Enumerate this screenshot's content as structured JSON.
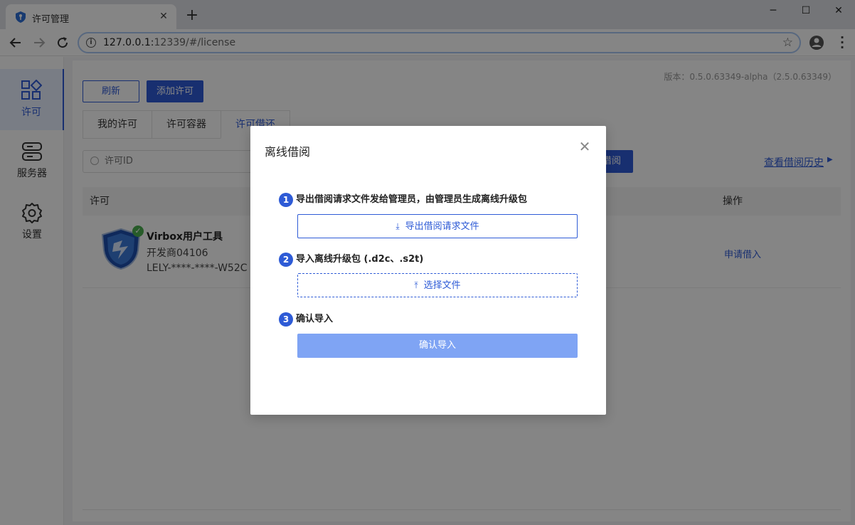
{
  "browser": {
    "tab_title": "许可管理",
    "url_host": "127.0.0.1:",
    "url_rest": "12339/#/license"
  },
  "sidebar": {
    "items": [
      {
        "label": "许可",
        "icon": "apps-grid-icon",
        "active": true
      },
      {
        "label": "服务器",
        "icon": "server-icon",
        "active": false
      },
      {
        "label": "设置",
        "icon": "gear-icon",
        "active": false
      }
    ]
  },
  "main": {
    "version": "版本：0.5.0.63349-alpha（2.5.0.63349）",
    "refresh_label": "刷新",
    "add_label": "添加许可",
    "tabs": [
      {
        "label": "我的许可"
      },
      {
        "label": "许可容器"
      },
      {
        "label": "许可借还",
        "active": true
      }
    ],
    "search_placeholder": "许可ID",
    "borrow_label": "借阅",
    "history_link": "查看借阅历史",
    "table": {
      "headers": [
        "许可",
        "操作"
      ],
      "rows": [
        {
          "name": "Virbox用户工具",
          "vendor": "开发商04106",
          "key": "LELY-****-****-W52C",
          "action": "申请借入"
        }
      ]
    }
  },
  "modal": {
    "title": "离线借阅",
    "steps": [
      {
        "num": "1",
        "text": "导出借阅请求文件发给管理员，由管理员生成离线升级包",
        "button": "导出借阅请求文件"
      },
      {
        "num": "2",
        "text": "导入离线升级包 (.d2c、.s2t)",
        "button": "选择文件"
      },
      {
        "num": "3",
        "text": "确认导入",
        "button": "确认导入"
      }
    ]
  },
  "colors": {
    "primary": "#2e5bd6",
    "confirm_disabled": "#7fa4f4",
    "success": "#4caf50"
  }
}
